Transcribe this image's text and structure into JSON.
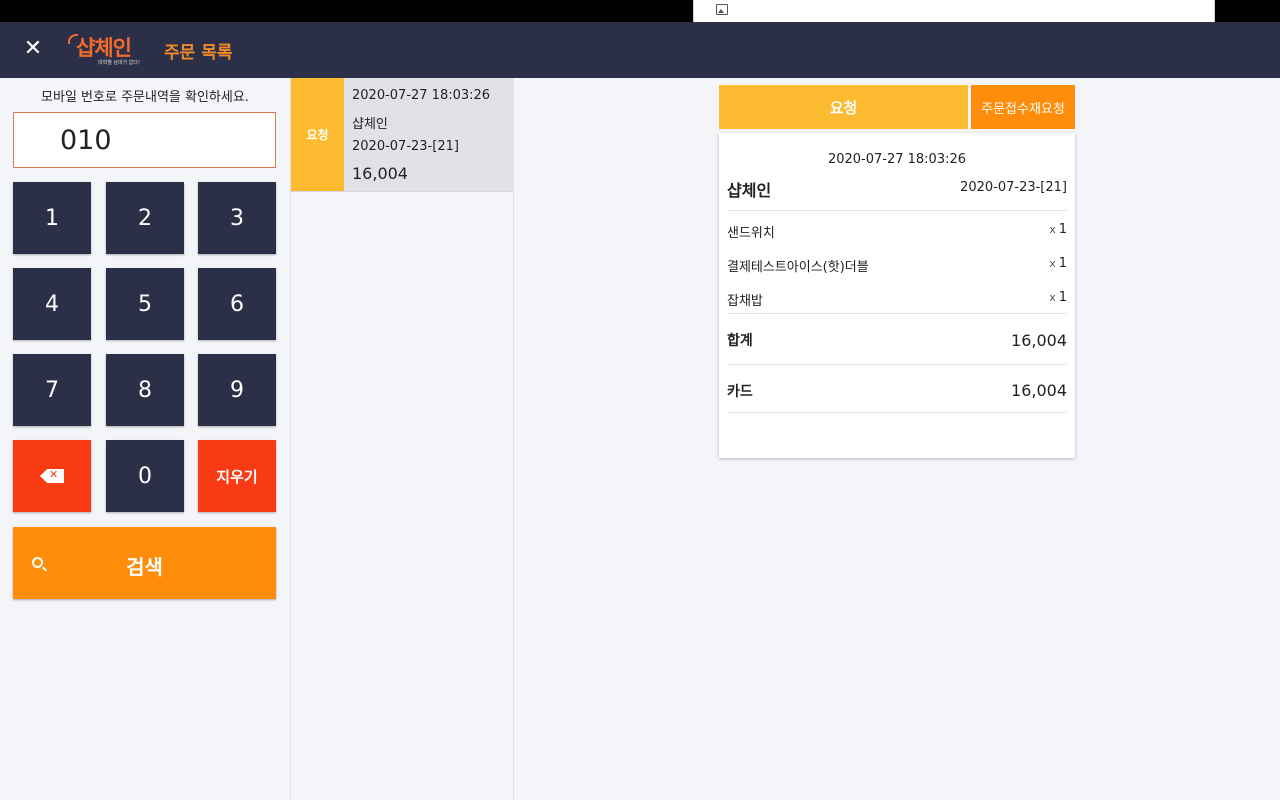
{
  "header": {
    "close_icon": "close-icon",
    "logo_text": "샵체인",
    "logo_tagline": "대학별 상대가 없다!",
    "title": "주문 목록"
  },
  "left": {
    "instruction": "모바일 번호로 주문내역을 확인하세요.",
    "phone_value": "010",
    "keys": [
      "1",
      "2",
      "3",
      "4",
      "5",
      "6",
      "7",
      "8",
      "9",
      "0"
    ],
    "clear_label": "지우기",
    "backspace_icon": "backspace-icon",
    "search_label": "검색",
    "search_icon": "search-icon"
  },
  "orders": [
    {
      "status": "요청",
      "datetime": "2020-07-27 18:03:26",
      "store": "샵체인",
      "order_no": "2020-07-23-[21]",
      "amount": "16,004"
    }
  ],
  "detail": {
    "request_button": "요청",
    "rerequest_button": "주문접수재요청",
    "datetime": "2020-07-27 18:03:26",
    "store": "샵체인",
    "order_no": "2020-07-23-[21]",
    "items": [
      {
        "name": "샌드위치",
        "qty_prefix": "x",
        "qty": "1"
      },
      {
        "name": "결제테스트아이스(핫)더블",
        "qty_prefix": "x",
        "qty": "1"
      },
      {
        "name": "잡채밥",
        "qty_prefix": "x",
        "qty": "1"
      }
    ],
    "total_label": "합계",
    "total_value": "16,004",
    "payment_label": "카드",
    "payment_value": "16,004"
  },
  "colors": {
    "appbar": "#2c2f48",
    "key_dark": "#2c2f48",
    "key_red": "#f83b12",
    "accent_orange": "#ff8c0a",
    "status_yellow": "#fcbb30",
    "title_orange": "#f28a2a"
  }
}
